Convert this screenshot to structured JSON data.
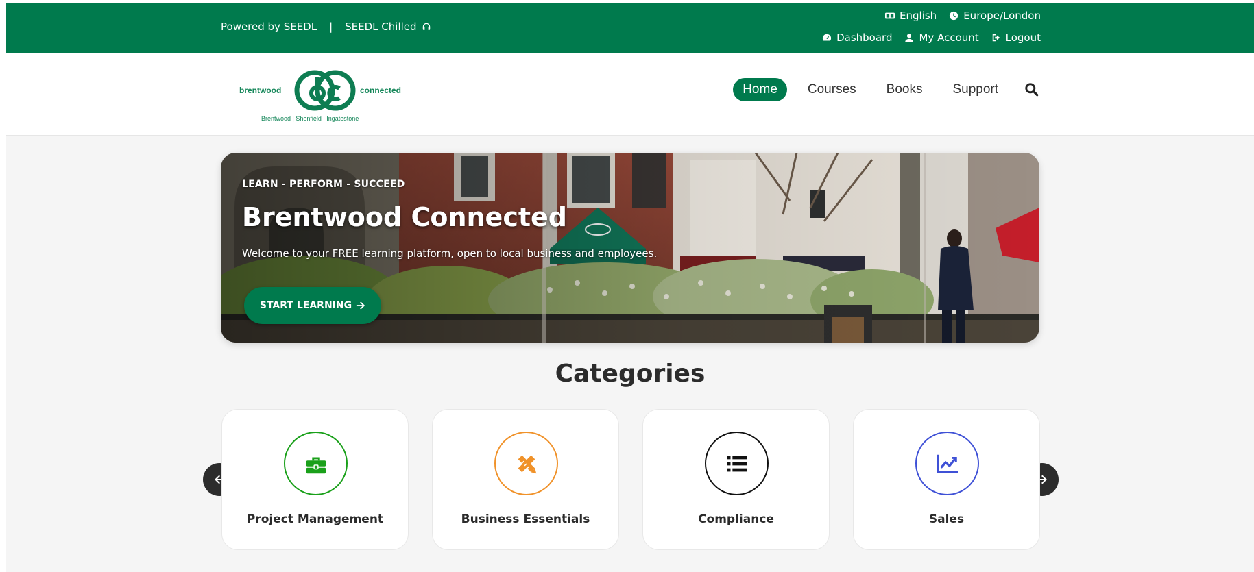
{
  "topbar": {
    "powered_by": "Powered by SEEDL",
    "separator": "|",
    "chilled": "SEEDL Chilled",
    "language": "English",
    "timezone": "Europe/London",
    "dashboard": "Dashboard",
    "my_account": "My Account",
    "logout": "Logout",
    "icons": [
      "headphones-icon",
      "language-icon",
      "clock-icon",
      "dashboard-icon",
      "user-icon",
      "logout-icon"
    ]
  },
  "logo": {
    "left_word": "brentwood",
    "right_word": "connected",
    "tagline": "Brentwood  |  Shenfield  |  Ingatestone"
  },
  "nav": {
    "items": [
      {
        "label": "Home",
        "active": true
      },
      {
        "label": "Courses",
        "active": false
      },
      {
        "label": "Books",
        "active": false
      },
      {
        "label": "Support",
        "active": false
      }
    ],
    "search_icon": "search-icon"
  },
  "hero": {
    "kicker": "LEARN - PERFORM - SUCCEED",
    "title": "Brentwood Connected",
    "subtitle": "Welcome to your FREE learning platform, open to local business and employees.",
    "button": "START LEARNING"
  },
  "categories": {
    "title": "Categories",
    "items": [
      {
        "label": "Project Management",
        "icon": "briefcase-icon",
        "color": "#1aa01a"
      },
      {
        "label": "Business Essentials",
        "icon": "pencil-ruler-icon",
        "color": "#f0922a"
      },
      {
        "label": "Compliance",
        "icon": "list-icon",
        "color": "#111111"
      },
      {
        "label": "Sales",
        "icon": "chart-line-icon",
        "color": "#3f51d6"
      }
    ]
  },
  "colors": {
    "brand_green": "#007a4d",
    "page_bg": "#f5f5f5"
  }
}
